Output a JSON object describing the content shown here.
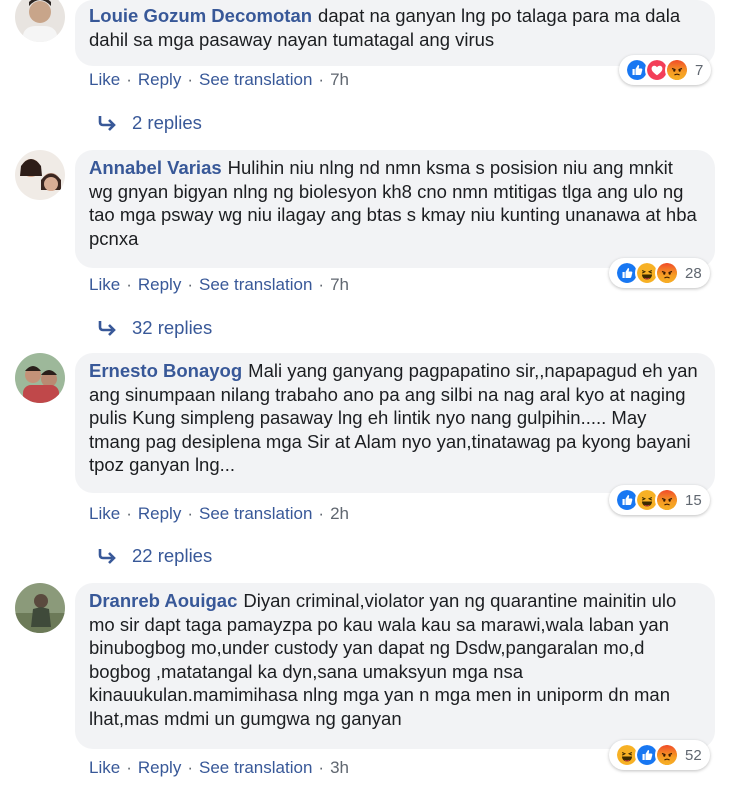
{
  "actions": {
    "like": "Like",
    "reply": "Reply",
    "see_translation": "See translation"
  },
  "comments": [
    {
      "author": "Louie Gozum Decomotan",
      "text": "dapat na ganyan lng po talaga para ma dala dahil sa mga pasaway nayan tumatagal ang virus",
      "time": "7h",
      "reaction_count": "7",
      "reaction_icons": [
        "like-icon",
        "love-icon",
        "angry-icon"
      ],
      "replies": "2 replies"
    },
    {
      "author": "Annabel Varias",
      "text": "Hulihin niu nlng nd nmn ksma s posision niu ang mnkit wg gnyan bigyan nlng ng biolesyon kh8 cno nmn mtitigas tlga ang ulo ng tao mga psway wg niu ilagay ang btas s kmay niu kunting unanawa at hba pcnxa",
      "time": "7h",
      "reaction_count": "28",
      "reaction_icons": [
        "like-icon",
        "haha-icon",
        "angry-icon"
      ],
      "replies": "32 replies"
    },
    {
      "author": "Ernesto Bonayog",
      "text": "Mali yang ganyang pagpapatino sir,,napapagud eh yan ang sinumpaan nilang trabaho ano pa ang silbi na nag aral kyo at naging pulis Kung simpleng pasaway lng eh lintik nyo nang gulpihin..... May tmang pag desiplena mga Sir at Alam nyo yan,tinatawag pa kyong bayani tpoz ganyan lng...",
      "time": "2h",
      "reaction_count": "15",
      "reaction_icons": [
        "like-icon",
        "haha-icon",
        "angry-icon"
      ],
      "replies": "22 replies"
    },
    {
      "author": "Dranreb Aouigac",
      "text": "Diyan criminal,violator yan ng quarantine mainitin ulo mo sir dapt taga pamayzpa po kau wala kau sa marawi,wala laban yan binubogbog mo,under custody yan dapat ng Dsdw,pangaralan mo,d bogbog ,matatangal ka dyn,sana umaksyun mga nsa kinauukulan.mamimihasa nlng mga yan n mga men in uniporm dn man lhat,mas mdmi un gumgwa ng ganyan",
      "time": "3h",
      "reaction_count": "52",
      "reaction_icons": [
        "haha-icon",
        "like-icon",
        "angry-icon"
      ]
    }
  ],
  "colors": {
    "link": "#385898",
    "bubble": "#f2f3f5",
    "like": "#1877f2",
    "love": "#f33e58",
    "angry": "#e9710f",
    "haha": "#f7b125"
  }
}
